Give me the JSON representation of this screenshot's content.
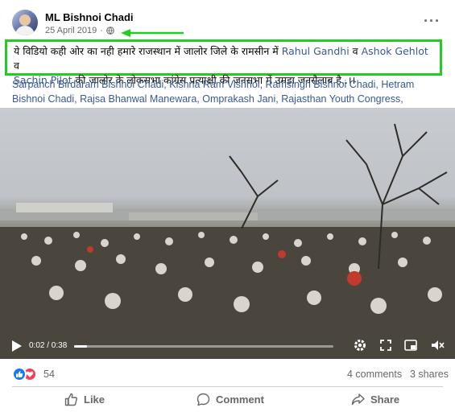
{
  "post": {
    "author": "ML Bishnoi Chadi",
    "date": "25 April 2019",
    "separator": "·",
    "privacy_icon": "globe-icon",
    "more_icon": "more-options-icon"
  },
  "body": {
    "text_before": "ये विडियो कही ओर का नही हमारे राजस्थान में जालोर जिले के रामसीन में ",
    "link1": "Rahul Gandhi",
    "join1": " व ",
    "link2": "Ashok Gehlot",
    "join2": " व",
    "link3": "Sachin Pilot",
    "text_after": " की जालोर के लोकसभा कांग्रेस प्रत्याक्षी की जनसभा में उमड़ा जनसैलाब है..।।"
  },
  "tags": "Sarpanch Birdaram Bishnoi Chadi, Kishna Ram Vishnoi, Ramsingh Bishnoi Chadi, Hetram Bishnoi Chadi, Rajsa Bhanwal Manewara, Omprakash Jani, Rajasthan Youth Congress,",
  "video": {
    "time": "0:02 / 0:38",
    "progress": 0.05,
    "icons": [
      "play-icon",
      "settings-icon",
      "fullscreen-icon",
      "pip-icon",
      "volume-muted-icon"
    ]
  },
  "stats": {
    "reaction_count": "54",
    "comments": "4 comments",
    "shares": "3 shares"
  },
  "actions": {
    "like": "Like",
    "comment": "Comment",
    "share": "Share"
  },
  "colors": {
    "highlight_border": "#22cc22",
    "link": "#385898",
    "like_blue": "#1877f2",
    "love_red": "#f33e58"
  }
}
